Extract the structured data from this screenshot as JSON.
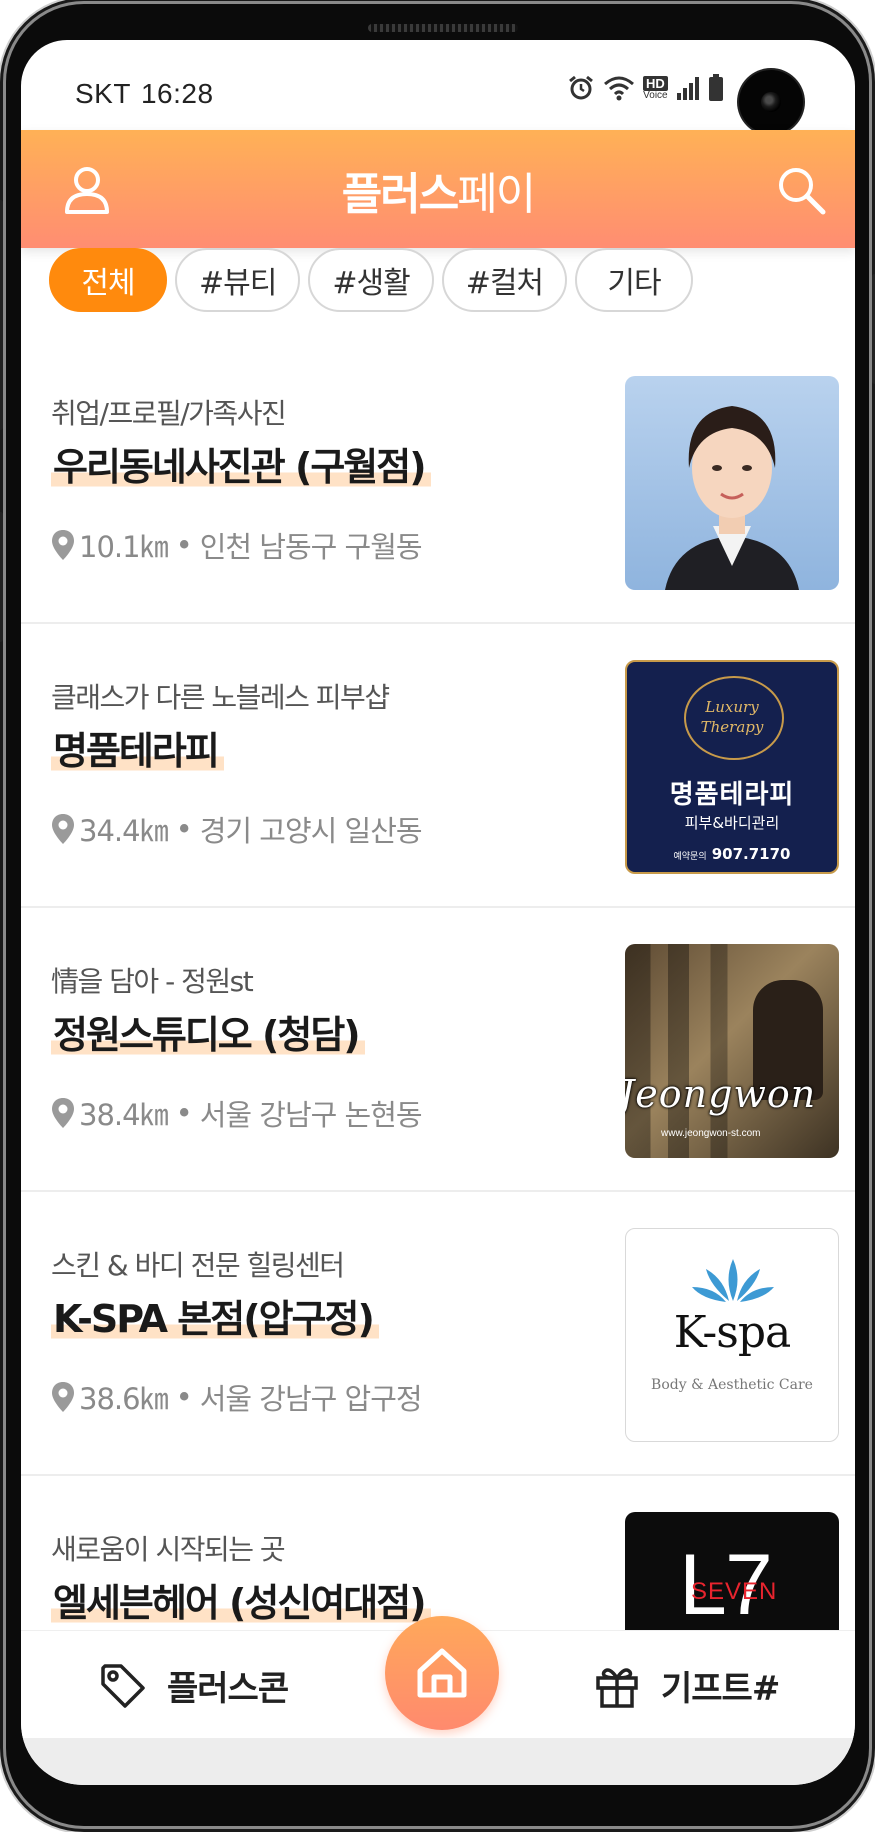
{
  "status_bar": {
    "carrier": "SKT",
    "time": "16:28",
    "icons": [
      "alarm-icon",
      "wifi-icon",
      "hd-voice-icon",
      "signal-icon",
      "battery-icon"
    ],
    "hd_label": "HD",
    "voice_label": "Voice"
  },
  "header": {
    "title_bold": "플러스",
    "title_rest": "페이",
    "left_icon": "user-icon",
    "right_icon": "search-icon",
    "gradient": [
      "#ffb156",
      "#ff8d72"
    ]
  },
  "filters": [
    {
      "label": "전체",
      "active": true
    },
    {
      "label": "#뷰티",
      "active": false
    },
    {
      "label": "#생활",
      "active": false
    },
    {
      "label": "#컬처",
      "active": false
    },
    {
      "label": "기타",
      "active": false
    }
  ],
  "stores": [
    {
      "subtitle": "취업/프로필/가족사진",
      "title": "우리동네사진관 (구월점)",
      "distance": "10.1㎞",
      "separator": "•",
      "address": "인천 남동구 구월동"
    },
    {
      "subtitle": "클래스가 다른 노블레스 피부샵",
      "title": "명품테라피",
      "distance": "34.4㎞",
      "separator": "•",
      "address": "경기 고양시 일산동",
      "image_text": {
        "script_line1": "Luxury",
        "script_line2": "Therapy",
        "name": "명품테라피",
        "desc": "피부&바디관리",
        "phone_label": "예약문의",
        "phone": "907.7170"
      }
    },
    {
      "subtitle": "情을 담아 - 정원st",
      "title": "정원스튜디오 (청담)",
      "distance": "38.4㎞",
      "separator": "•",
      "address": "서울 강남구 논현동",
      "image_text": {
        "brand": "Jeongwon",
        "url": "www.jeongwon-st.com"
      }
    },
    {
      "subtitle": "스킨 & 바디 전문 힐링센터",
      "title": "K-SPA 본점(압구정)",
      "distance": "38.6㎞",
      "separator": "•",
      "address": "서울 강남구 압구정",
      "image_text": {
        "brand": "K-spa",
        "tagline": "Body & Aesthetic Care"
      }
    },
    {
      "subtitle": "새로움이 시작되는 곳",
      "title": "엘세븐헤어 (성신여대점)",
      "distance": "",
      "separator": "",
      "address": "",
      "image_text": {
        "letter": "L",
        "number": "7",
        "word": "SEVEN"
      }
    }
  ],
  "bottom_nav": {
    "left_label": "플러스콘",
    "left_icon": "tag-icon",
    "center_icon": "home-icon",
    "right_label": "기프트#",
    "right_icon": "gift-icon"
  },
  "colors": {
    "accent": "#ff8a0d",
    "title_highlight": "#ffe2c6",
    "home_button": "#ff9a64"
  }
}
